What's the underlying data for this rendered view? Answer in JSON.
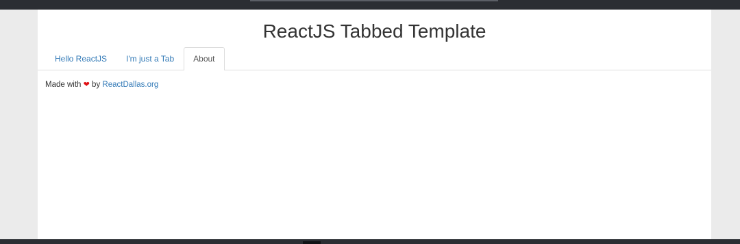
{
  "page": {
    "title": "ReactJS Tabbed Template"
  },
  "tabs": [
    {
      "label": "Hello ReactJS",
      "active": false
    },
    {
      "label": "I'm just a Tab",
      "active": false
    },
    {
      "label": "About",
      "active": true
    }
  ],
  "content": {
    "made_with": "Made with",
    "heart": "❤",
    "by": "by",
    "link_text": "ReactDallas.org"
  },
  "colors": {
    "link": "#337ab7",
    "heart": "#e00f14",
    "text": "#333333",
    "background": "#ebebeb"
  }
}
